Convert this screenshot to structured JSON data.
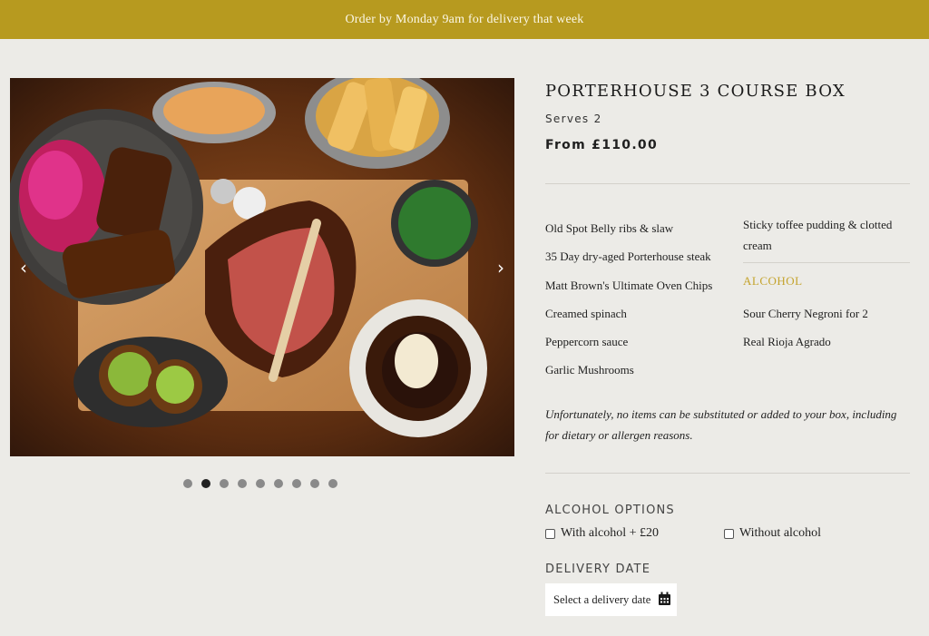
{
  "banner": {
    "text": "Order by Monday 9am for delivery that week"
  },
  "gallery": {
    "prev_icon": "chevron-left-icon",
    "next_icon": "chevron-right-icon",
    "slide_count": 9,
    "active_slide": 2
  },
  "product": {
    "title": "PORTERHOUSE 3 COURSE BOX",
    "serves": "Serves 2",
    "price": "From £110.00",
    "items_left": [
      "Old Spot Belly ribs & slaw",
      "35 Day dry-aged Porterhouse steak",
      "Matt Brown's Ultimate Oven Chips",
      "Creamed spinach",
      "Peppercorn sauce",
      "Garlic Mushrooms"
    ],
    "dessert": "Sticky toffee pudding & clotted cream",
    "alcohol_heading": "ALCOHOL",
    "alcohol_items": [
      "Sour Cherry Negroni for 2",
      "Real Rioja Agrado"
    ],
    "disclaimer": "Unfortunately, no items can be substituted or added to your box, including for dietary or allergen reasons."
  },
  "alcohol_options": {
    "label": "ALCOHOL OPTIONS",
    "with_alcohol": "With alcohol + £20",
    "without_alcohol": "Without alcohol"
  },
  "delivery": {
    "label": "DELIVERY DATE",
    "placeholder": "Select a delivery date",
    "icon": "calendar-icon"
  },
  "colors": {
    "banner_bg": "#b79a1f",
    "page_bg": "#ecebe7",
    "accent_gold": "#c4a32c"
  }
}
